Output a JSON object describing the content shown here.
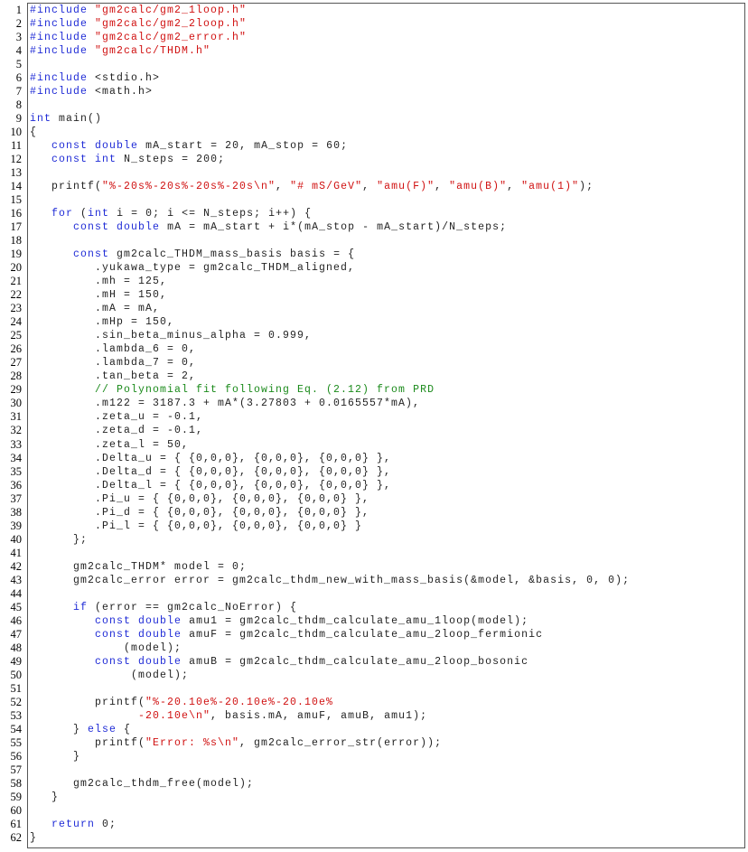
{
  "colors": {
    "keyword": "#1f2bd6",
    "string": "#d01010",
    "comment": "#1a8a1a",
    "text": "#222222"
  },
  "lines": [
    [
      [
        "kw",
        "#include"
      ],
      [
        "plain",
        " "
      ],
      [
        "str",
        "\"gm2calc/gm2_1loop.h\""
      ]
    ],
    [
      [
        "kw",
        "#include"
      ],
      [
        "plain",
        " "
      ],
      [
        "str",
        "\"gm2calc/gm2_2loop.h\""
      ]
    ],
    [
      [
        "kw",
        "#include"
      ],
      [
        "plain",
        " "
      ],
      [
        "str",
        "\"gm2calc/gm2_error.h\""
      ]
    ],
    [
      [
        "kw",
        "#include"
      ],
      [
        "plain",
        " "
      ],
      [
        "str",
        "\"gm2calc/THDM.h\""
      ]
    ],
    [],
    [
      [
        "kw",
        "#include"
      ],
      [
        "plain",
        " <stdio.h>"
      ]
    ],
    [
      [
        "kw",
        "#include"
      ],
      [
        "plain",
        " <math.h>"
      ]
    ],
    [],
    [
      [
        "kw",
        "int"
      ],
      [
        "plain",
        " main()"
      ]
    ],
    [
      [
        "plain",
        "{"
      ]
    ],
    [
      [
        "plain",
        "   "
      ],
      [
        "kw",
        "const"
      ],
      [
        "plain",
        " "
      ],
      [
        "kw",
        "double"
      ],
      [
        "plain",
        " mA_start = 20, mA_stop = 60;"
      ]
    ],
    [
      [
        "plain",
        "   "
      ],
      [
        "kw",
        "const"
      ],
      [
        "plain",
        " "
      ],
      [
        "kw",
        "int"
      ],
      [
        "plain",
        " N_steps = 200;"
      ]
    ],
    [],
    [
      [
        "plain",
        "   printf("
      ],
      [
        "str",
        "\"%-20s%-20s%-20s%-20s\\n\""
      ],
      [
        "plain",
        ", "
      ],
      [
        "str",
        "\"# mS/GeV\""
      ],
      [
        "plain",
        ", "
      ],
      [
        "str",
        "\"amu(F)\""
      ],
      [
        "plain",
        ", "
      ],
      [
        "str",
        "\"amu(B)\""
      ],
      [
        "plain",
        ", "
      ],
      [
        "str",
        "\"amu(1)\""
      ],
      [
        "plain",
        ");"
      ]
    ],
    [],
    [
      [
        "plain",
        "   "
      ],
      [
        "kw",
        "for"
      ],
      [
        "plain",
        " ("
      ],
      [
        "kw",
        "int"
      ],
      [
        "plain",
        " i = 0; i <= N_steps; i++) {"
      ]
    ],
    [
      [
        "plain",
        "      "
      ],
      [
        "kw",
        "const"
      ],
      [
        "plain",
        " "
      ],
      [
        "kw",
        "double"
      ],
      [
        "plain",
        " mA = mA_start + i*(mA_stop - mA_start)/N_steps;"
      ]
    ],
    [],
    [
      [
        "plain",
        "      "
      ],
      [
        "kw",
        "const"
      ],
      [
        "plain",
        " gm2calc_THDM_mass_basis basis = {"
      ]
    ],
    [
      [
        "plain",
        "         .yukawa_type = gm2calc_THDM_aligned,"
      ]
    ],
    [
      [
        "plain",
        "         .mh = 125,"
      ]
    ],
    [
      [
        "plain",
        "         .mH = 150,"
      ]
    ],
    [
      [
        "plain",
        "         .mA = mA,"
      ]
    ],
    [
      [
        "plain",
        "         .mHp = 150,"
      ]
    ],
    [
      [
        "plain",
        "         .sin_beta_minus_alpha = 0.999,"
      ]
    ],
    [
      [
        "plain",
        "         .lambda_6 = 0,"
      ]
    ],
    [
      [
        "plain",
        "         .lambda_7 = 0,"
      ]
    ],
    [
      [
        "plain",
        "         .tan_beta = 2,"
      ]
    ],
    [
      [
        "plain",
        "         "
      ],
      [
        "com",
        "// Polynomial fit following Eq. (2.12) from PRD"
      ]
    ],
    [
      [
        "plain",
        "         .m122 = 3187.3 + mA*(3.27803 + 0.0165557*mA),"
      ]
    ],
    [
      [
        "plain",
        "         .zeta_u = -0.1,"
      ]
    ],
    [
      [
        "plain",
        "         .zeta_d = -0.1,"
      ]
    ],
    [
      [
        "plain",
        "         .zeta_l = 50,"
      ]
    ],
    [
      [
        "plain",
        "         .Delta_u = { {0,0,0}, {0,0,0}, {0,0,0} },"
      ]
    ],
    [
      [
        "plain",
        "         .Delta_d = { {0,0,0}, {0,0,0}, {0,0,0} },"
      ]
    ],
    [
      [
        "plain",
        "         .Delta_l = { {0,0,0}, {0,0,0}, {0,0,0} },"
      ]
    ],
    [
      [
        "plain",
        "         .Pi_u = { {0,0,0}, {0,0,0}, {0,0,0} },"
      ]
    ],
    [
      [
        "plain",
        "         .Pi_d = { {0,0,0}, {0,0,0}, {0,0,0} },"
      ]
    ],
    [
      [
        "plain",
        "         .Pi_l = { {0,0,0}, {0,0,0}, {0,0,0} }"
      ]
    ],
    [
      [
        "plain",
        "      };"
      ]
    ],
    [],
    [
      [
        "plain",
        "      gm2calc_THDM* model = 0;"
      ]
    ],
    [
      [
        "plain",
        "      gm2calc_error error = gm2calc_thdm_new_with_mass_basis(&model, &basis, 0, 0);"
      ]
    ],
    [],
    [
      [
        "plain",
        "      "
      ],
      [
        "kw",
        "if"
      ],
      [
        "plain",
        " (error == gm2calc_NoError) {"
      ]
    ],
    [
      [
        "plain",
        "         "
      ],
      [
        "kw",
        "const"
      ],
      [
        "plain",
        " "
      ],
      [
        "kw",
        "double"
      ],
      [
        "plain",
        " amu1 = gm2calc_thdm_calculate_amu_1loop(model);"
      ]
    ],
    [
      [
        "plain",
        "         "
      ],
      [
        "kw",
        "const"
      ],
      [
        "plain",
        " "
      ],
      [
        "kw",
        "double"
      ],
      [
        "plain",
        " amuF = gm2calc_thdm_calculate_amu_2loop_fermionic"
      ]
    ],
    [
      [
        "plain",
        "             (model);"
      ]
    ],
    [
      [
        "plain",
        "         "
      ],
      [
        "kw",
        "const"
      ],
      [
        "plain",
        " "
      ],
      [
        "kw",
        "double"
      ],
      [
        "plain",
        " amuB = gm2calc_thdm_calculate_amu_2loop_bosonic"
      ]
    ],
    [
      [
        "plain",
        "              (model);"
      ]
    ],
    [],
    [
      [
        "plain",
        "         printf("
      ],
      [
        "str",
        "\"%-20.10e%-20.10e%-20.10e%"
      ]
    ],
    [
      [
        "plain",
        "               "
      ],
      [
        "str",
        "-20.10e\\n\""
      ],
      [
        "plain",
        ", basis.mA, amuF, amuB, amu1);"
      ]
    ],
    [
      [
        "plain",
        "      } "
      ],
      [
        "kw",
        "else"
      ],
      [
        "plain",
        " {"
      ]
    ],
    [
      [
        "plain",
        "         printf("
      ],
      [
        "str",
        "\"Error: %s\\n\""
      ],
      [
        "plain",
        ", gm2calc_error_str(error));"
      ]
    ],
    [
      [
        "plain",
        "      }"
      ]
    ],
    [],
    [
      [
        "plain",
        "      gm2calc_thdm_free(model);"
      ]
    ],
    [
      [
        "plain",
        "   }"
      ]
    ],
    [],
    [
      [
        "plain",
        "   "
      ],
      [
        "kw",
        "return"
      ],
      [
        "plain",
        " 0;"
      ]
    ],
    [
      [
        "plain",
        "}"
      ]
    ]
  ]
}
